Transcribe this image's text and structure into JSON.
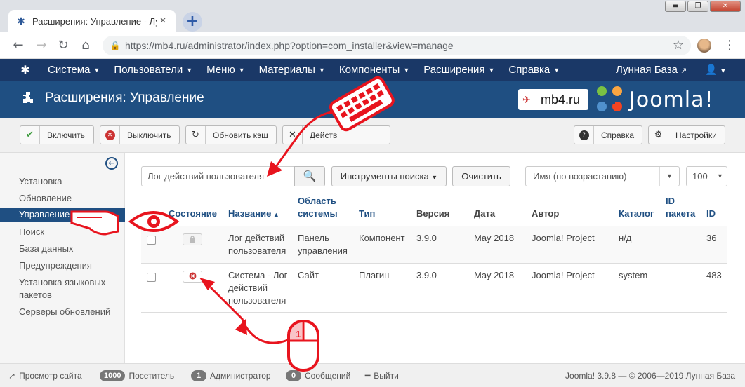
{
  "browser": {
    "tab_title": "Расширения: Управление - Лунна",
    "url": "https://mb4.ru/administrator/index.php?option=com_installer&view=manage",
    "window_controls": [
      "▬",
      "❐",
      "✕"
    ]
  },
  "topnav": {
    "items": [
      "Система",
      "Пользователи",
      "Меню",
      "Материалы",
      "Компоненты",
      "Расширения",
      "Справка"
    ],
    "site_link": "Лунная База",
    "caret": "▼"
  },
  "header": {
    "title": "Расширения: Управление",
    "mb4_logo": "mb4.ru",
    "joomla_logo": "Joomla!"
  },
  "toolbar": {
    "enable": "Включить",
    "disable": "Выключить",
    "refresh_cache": "Обновить кэш",
    "actions_partial": "Действ",
    "help": "Справка",
    "settings": "Настройки"
  },
  "sidebar": {
    "items": [
      "Установка",
      "Обновление",
      "Управление",
      "Поиск",
      "База данных",
      "Предупреждения",
      "Установка языковых пакетов",
      "Серверы обновлений"
    ]
  },
  "filters": {
    "search_value": "Лог действий пользователя",
    "search_tools": "Инструменты поиска",
    "clear": "Очистить",
    "sort": "Имя (по возрастанию)",
    "limit": "100"
  },
  "table": {
    "headers": {
      "status": "Состояние",
      "name": "Название",
      "area": "Область системы",
      "type": "Тип",
      "version": "Версия",
      "date": "Дата",
      "author": "Автор",
      "folder": "Каталог",
      "package_id": "ID пакета",
      "id": "ID"
    },
    "rows": [
      {
        "name": "Лог действий пользователя",
        "area": "Панель управления",
        "type": "Компонент",
        "version": "3.9.0",
        "date": "May 2018",
        "author": "Joomla! Project",
        "folder": "н/д",
        "id": "36",
        "status": "locked"
      },
      {
        "name": "Система - Лог действий пользователя",
        "area": "Сайт",
        "type": "Плагин",
        "version": "3.9.0",
        "date": "May 2018",
        "author": "Joomla! Project",
        "folder": "system",
        "id": "483",
        "status": "disabled"
      }
    ]
  },
  "footer": {
    "view_site": "Просмотр сайта",
    "visitors_count": "1000",
    "visitors_label": "Посетитель",
    "admins_count": "1",
    "admins_label": "Администратор",
    "messages_count": "0",
    "messages_label": "Сообщений",
    "logout": "Выйти",
    "copyright": "Joomla! 3.9.8 — © 2006—2019 Лунная База"
  },
  "annotation": {
    "mouse_number": "1"
  },
  "colors": {
    "nav_bg": "#1a3867",
    "header_bg": "#1f4f82",
    "annotation_red": "#e8141e"
  }
}
